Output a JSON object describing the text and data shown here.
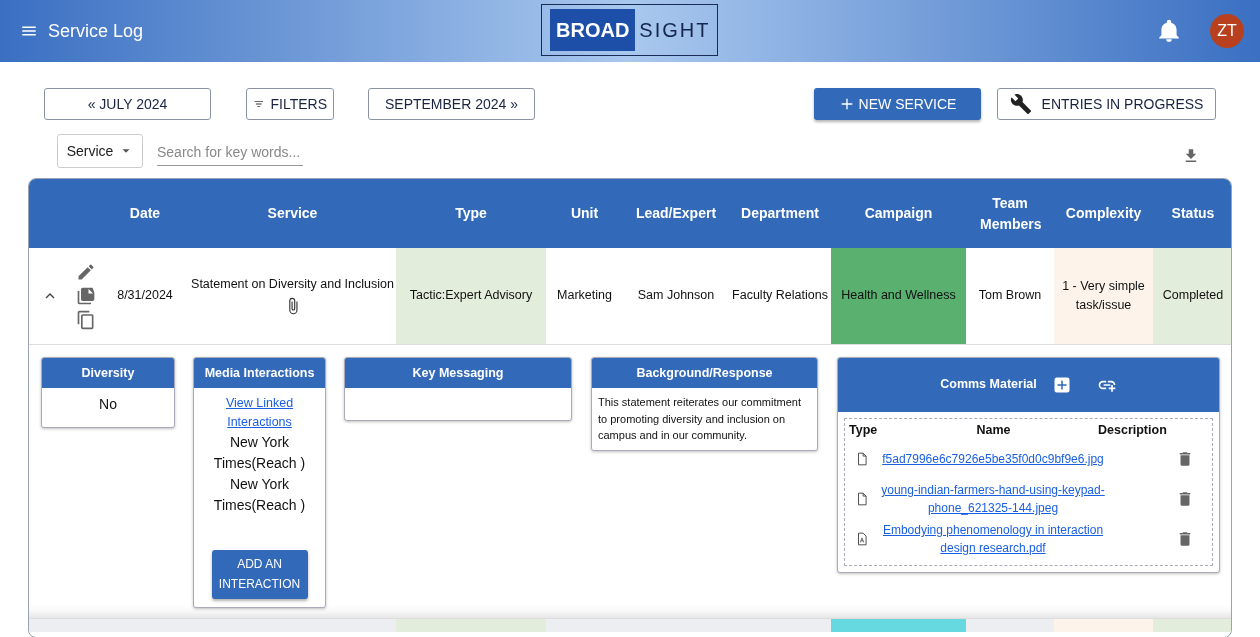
{
  "app_bar": {
    "title": "Service Log",
    "logo": [
      "BROAD",
      "SIGHT"
    ],
    "avatar": "ZT"
  },
  "toolbar": {
    "prev_month": "« JULY 2024",
    "filters": "FILTERS",
    "next_month": "SEPTEMBER 2024 »",
    "new_service": "NEW SERVICE",
    "entries": "ENTRIES IN PROGRESS"
  },
  "search": {
    "scope": "Service",
    "placeholder": "Search for key words..."
  },
  "table": {
    "columns": [
      "Date",
      "Service",
      "Type",
      "Unit",
      "Lead/Expert",
      "Department",
      "Campaign",
      "Team Members",
      "Complexity",
      "Status"
    ],
    "rows": [
      {
        "expanded": true,
        "has_attachment": true,
        "cells": [
          {
            "text": "8/31/2024"
          },
          {
            "text": "Statement on Diversity and Inclusion"
          },
          {
            "text": "Tactic:Expert Advisory",
            "color": "#e3eddb"
          },
          {
            "text": "Marketing"
          },
          {
            "text": "Sam Johnson"
          },
          {
            "text": "Faculty Relations"
          },
          {
            "text": "Health and Wellness",
            "color": "#5ab06e"
          },
          {
            "text": "Tom Brown"
          },
          {
            "text": "1 - Very simple task/issue",
            "color": "#fdf3ea"
          },
          {
            "text": "Completed",
            "color": "#e3eddb"
          }
        ]
      }
    ],
    "next_row": {
      "type": {
        "color": "#e3eddb"
      },
      "campaign": {
        "color": "#66d9e0"
      },
      "complexity": {
        "color": "#fdf3ea"
      },
      "status": {
        "color": "#e3eddb"
      }
    }
  },
  "details": {
    "diversity": {
      "title": "Diversity",
      "value": "No"
    },
    "media": {
      "title": "Media Interactions",
      "link": "View Linked Interactions",
      "items": [
        "New York Times(Reach )",
        "New York Times(Reach )"
      ],
      "button": "ADD AN INTERACTION"
    },
    "key_messaging": {
      "title": "Key Messaging"
    },
    "background": {
      "title": "Background/Response",
      "text": "This statement reiterates our commitment to promoting diversity and inclusion on campus and in our community."
    },
    "comms": {
      "title": "Comms Material",
      "columns": [
        "Type",
        "Name",
        "Description"
      ],
      "files": [
        {
          "kind": "file",
          "name": "f5ad7996e6c7926e5be35f0d0c9bf9e6.jpg"
        },
        {
          "kind": "file",
          "name": "young-indian-farmers-hand-using-keypad-phone_621325-144.jpeg"
        },
        {
          "kind": "pdf",
          "name": "Embodying phenomenology in interaction design research.pdf"
        }
      ]
    }
  }
}
